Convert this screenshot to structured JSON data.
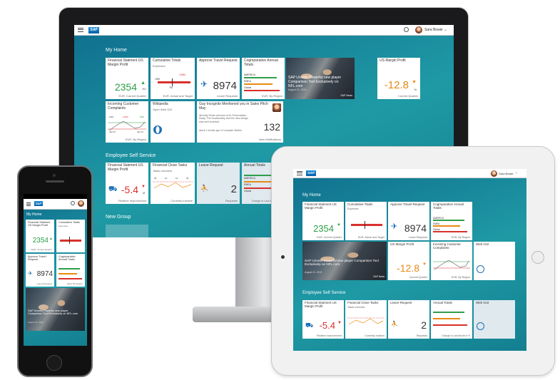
{
  "shell": {
    "logo": "SAP",
    "user_name": "Sara Bowie"
  },
  "groups": {
    "home": "My Home",
    "ess": "Employee Self Service",
    "new": "New Group"
  },
  "tiles": {
    "fin": {
      "title": "Financial Statment US Margin Profit",
      "value": "2354",
      "unit": "Mio",
      "footer": "EUR, Current Quarter"
    },
    "cum": {
      "title": "Cumulative Totals",
      "subtitle": "Expenses",
      "v1": "125M",
      "v2": "10M",
      "v3": "7M",
      "footer": "EUR, Actual and Target"
    },
    "travel": {
      "title": "Approve Travel Request",
      "value": "8974",
      "footer": "Leave Requests"
    },
    "comp": {
      "title": "Cogmparative Annual Totals",
      "r1": "AMERICA",
      "r1v": "125M",
      "r2": "EMEA",
      "r2v": "125M",
      "r3": "Global",
      "r3v": "125M",
      "footer": "EUR, By Region"
    },
    "news": {
      "caption": "SAP Unveils Powerful new player Comparison Tool Exclusively on NFL.com",
      "date": "August 21, 2013",
      "source": "SAP News"
    },
    "usm": {
      "title": "US Margin Profit",
      "value": "-12.8",
      "unit": "%",
      "footer": "Current Quarter"
    },
    "cust": {
      "title": "Incoming Customer Complaints",
      "a": "10M",
      "b": "125M",
      "c": "50M",
      "d": "3M",
      "e": "25M",
      "j1": "Jan 01",
      "j2": "Jan 31",
      "footer": "EUR, By Region"
    },
    "wiki": {
      "title": "Wikipedia",
      "subtitle": "Open Web GUI"
    },
    "webgui": {
      "title": "Web GUI"
    },
    "guy": {
      "title": "Guy Incognito Mentioned you in Sales Pitch May",
      "body": "@nrolfy Great outcome of th Presentation today. The functionality and the new design was well received.",
      "time": "about 1 minute ago in Computer Market",
      "value": "132",
      "footer": "New Notifications"
    },
    "fin2": {
      "title": "Financial Statment US Margin Profit",
      "value": "-5.4",
      "unit": "M",
      "footer": "Relative Improvement"
    },
    "close": {
      "title": "Financial Close Tasks",
      "subtitle": "Tasks overview",
      "n1": "25",
      "n2": "10",
      "n3": "10",
      "n4": "25",
      "footer": "Currently inactive"
    },
    "leave": {
      "title": "Leave Request",
      "value": "2",
      "footer": "Requests"
    },
    "annual": {
      "title": "Annual Totals",
      "footer": "Change to Last Month in %",
      "footer_tablet": "Change to Last Month in %"
    },
    "mini_b": "125M",
    "sapnews": "SAP NEWS"
  }
}
